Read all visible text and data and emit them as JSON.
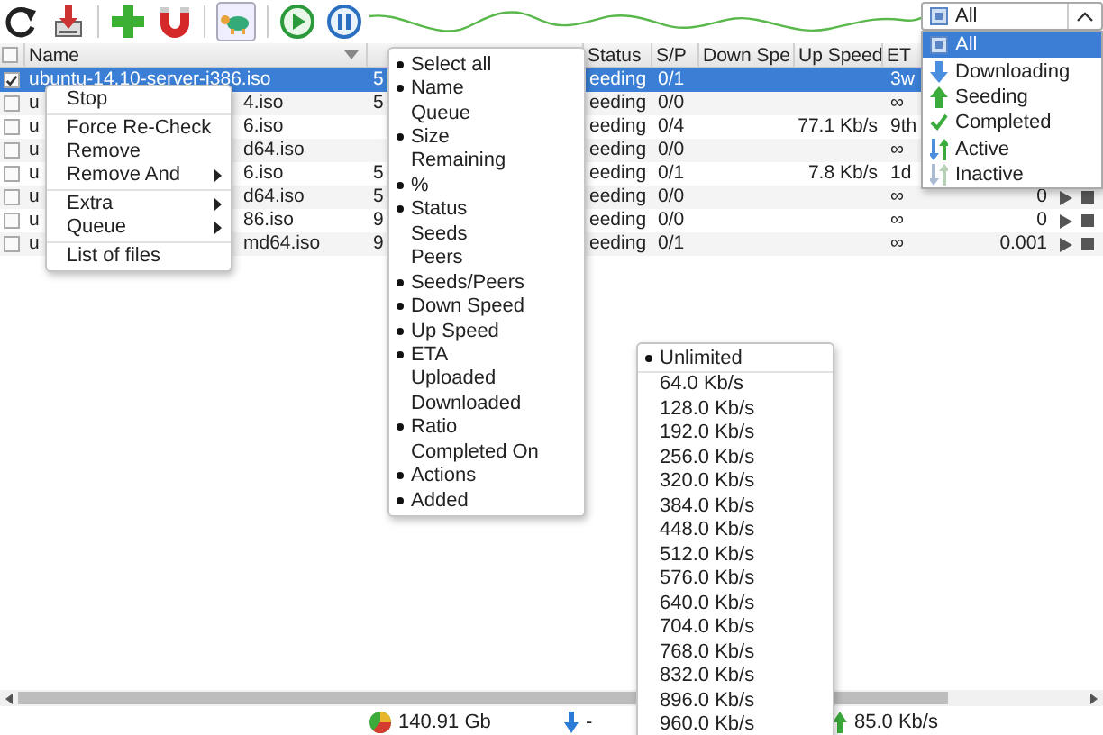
{
  "filter": {
    "value": "All",
    "options": [
      {
        "label": "All",
        "selected": true
      },
      {
        "label": "Downloading",
        "selected": false
      },
      {
        "label": "Seeding",
        "selected": false
      },
      {
        "label": "Completed",
        "selected": false
      },
      {
        "label": "Active",
        "selected": false
      },
      {
        "label": "Inactive",
        "selected": false
      }
    ]
  },
  "table": {
    "header_checked": false,
    "columns": [
      {
        "label": "Name"
      },
      {
        "label": "Status"
      },
      {
        "label": "S/P"
      },
      {
        "label": "Down Spe"
      },
      {
        "label": "Up Speed"
      },
      {
        "label": "ET"
      }
    ],
    "rows": [
      {
        "checked": true,
        "selected": true,
        "name_start": "ubuntu-14.10-server-i386.iso",
        "size": "5",
        "status": "eeding",
        "sp": "0/1",
        "eta": "3w"
      },
      {
        "checked": false,
        "selected": false,
        "name_start": "u",
        "name_end": "4.iso",
        "size": "5",
        "status": "eeding",
        "sp": "0/0",
        "eta": "∞"
      },
      {
        "checked": false,
        "selected": false,
        "name_start": "u",
        "name_end": "6.iso",
        "status": "eeding",
        "sp": "0/4",
        "up_speed": "77.1 Kb/s",
        "eta": "9th"
      },
      {
        "checked": false,
        "selected": false,
        "name_start": "u",
        "name_end": "d64.iso",
        "status": "eeding",
        "sp": "0/0",
        "eta": "∞"
      },
      {
        "checked": false,
        "selected": false,
        "name_start": "u",
        "name_end": "6.iso",
        "size": "5",
        "status": "eeding",
        "sp": "0/1",
        "up_speed": "7.8 Kb/s",
        "eta": "1d"
      },
      {
        "checked": false,
        "selected": false,
        "name_start": "u",
        "name_end": "d64.iso",
        "size": "5",
        "status": "eeding",
        "sp": "0/0",
        "eta": "∞",
        "ratio": "0",
        "actions": true
      },
      {
        "checked": false,
        "selected": false,
        "name_start": "u",
        "name_end": "86.iso",
        "size": "9",
        "status": "eeding",
        "sp": "0/0",
        "eta": "∞",
        "ratio": "0",
        "actions": true
      },
      {
        "checked": false,
        "selected": false,
        "name_start": "u",
        "name_end": "md64.iso",
        "size": "9",
        "status": "eeding",
        "sp": "0/1",
        "eta": "∞",
        "ratio": "0.001",
        "actions": true
      }
    ]
  },
  "context_menu": {
    "groups": [
      [
        {
          "label": "Stop",
          "submenu": false
        }
      ],
      [
        {
          "label": "Force Re-Check",
          "submenu": false
        },
        {
          "label": "Remove",
          "submenu": false
        },
        {
          "label": "Remove And",
          "submenu": true
        }
      ],
      [
        {
          "label": "Extra",
          "submenu": true
        },
        {
          "label": "Queue",
          "submenu": true
        }
      ],
      [
        {
          "label": "List of files",
          "submenu": false
        }
      ]
    ]
  },
  "column_menu": {
    "items": [
      {
        "label": "Select all",
        "checked": true
      },
      {
        "label": "Name",
        "checked": true
      },
      {
        "label": "Queue",
        "checked": false
      },
      {
        "label": "Size",
        "checked": true
      },
      {
        "label": "Remaining",
        "checked": false
      },
      {
        "label": "%",
        "checked": true
      },
      {
        "label": "Status",
        "checked": true
      },
      {
        "label": "Seeds",
        "checked": false
      },
      {
        "label": "Peers",
        "checked": false
      },
      {
        "label": "Seeds/Peers",
        "checked": true
      },
      {
        "label": "Down Speed",
        "checked": true
      },
      {
        "label": "Up Speed",
        "checked": true
      },
      {
        "label": "ETA",
        "checked": true
      },
      {
        "label": "Uploaded",
        "checked": false
      },
      {
        "label": "Downloaded",
        "checked": false
      },
      {
        "label": "Ratio",
        "checked": true
      },
      {
        "label": "Completed On",
        "checked": false
      },
      {
        "label": "Actions",
        "checked": true
      },
      {
        "label": "Added",
        "checked": true
      }
    ]
  },
  "speed_menu": {
    "items": [
      {
        "label": "Unlimited",
        "selected": true
      },
      {
        "label": "64.0 Kb/s",
        "selected": false
      },
      {
        "label": "128.0 Kb/s",
        "selected": false
      },
      {
        "label": "192.0 Kb/s",
        "selected": false
      },
      {
        "label": "256.0 Kb/s",
        "selected": false
      },
      {
        "label": "320.0 Kb/s",
        "selected": false
      },
      {
        "label": "384.0 Kb/s",
        "selected": false
      },
      {
        "label": "448.0 Kb/s",
        "selected": false
      },
      {
        "label": "512.0 Kb/s",
        "selected": false
      },
      {
        "label": "576.0 Kb/s",
        "selected": false
      },
      {
        "label": "640.0 Kb/s",
        "selected": false
      },
      {
        "label": "704.0 Kb/s",
        "selected": false
      },
      {
        "label": "768.0 Kb/s",
        "selected": false
      },
      {
        "label": "832.0 Kb/s",
        "selected": false
      },
      {
        "label": "896.0 Kb/s",
        "selected": false
      },
      {
        "label": "960.0 Kb/s",
        "selected": false
      }
    ]
  },
  "status_bar": {
    "disk": "140.91 Gb",
    "down": "-",
    "up": "85.0 Kb/s"
  }
}
